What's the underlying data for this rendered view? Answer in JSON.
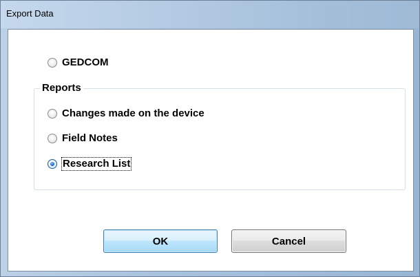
{
  "window": {
    "title": "Export Data"
  },
  "options": {
    "gedcom": {
      "label": "GEDCOM",
      "checked": false
    },
    "reports": {
      "legend": "Reports",
      "items": [
        {
          "label": "Changes made on the device",
          "checked": false
        },
        {
          "label": "Field Notes",
          "checked": false
        },
        {
          "label": "Research List",
          "checked": true
        }
      ]
    }
  },
  "buttons": {
    "ok": "OK",
    "cancel": "Cancel"
  }
}
